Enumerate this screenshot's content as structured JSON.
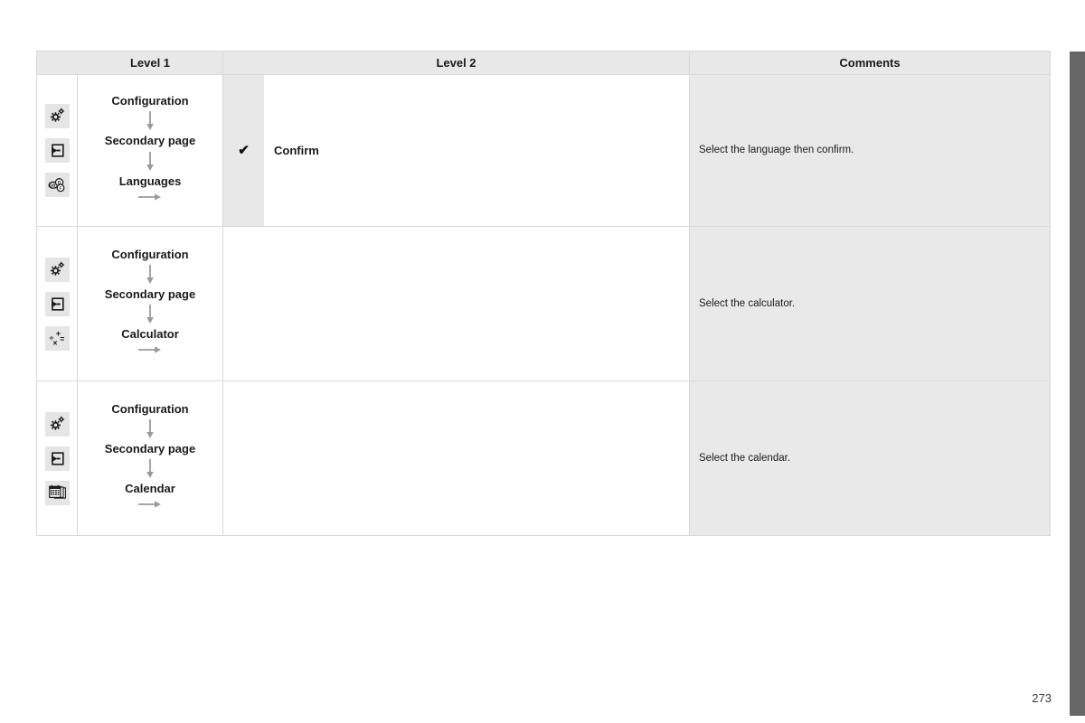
{
  "document": {
    "page_number": "273"
  },
  "table": {
    "headers": {
      "icons": "",
      "level1": "Level 1",
      "level2": "Level 2",
      "comments": "Comments"
    },
    "rows": [
      {
        "icons": [
          "gear-settings-icon",
          "enter-secondary-page-icon",
          "languages-discs-icon"
        ],
        "flow": [
          "Configuration",
          "Secondary page",
          "Languages"
        ],
        "check_mark": "✔",
        "level2_label": "Confirm",
        "comment": "Select the language then confirm."
      },
      {
        "icons": [
          "gear-settings-icon",
          "enter-secondary-page-icon",
          "calculator-icon"
        ],
        "flow": [
          "Configuration",
          "Secondary page",
          "Calculator"
        ],
        "check_mark": "",
        "level2_label": "",
        "comment": "Select the calculator."
      },
      {
        "icons": [
          "gear-settings-icon",
          "enter-secondary-page-icon",
          "calendar-icon"
        ],
        "flow": [
          "Configuration",
          "Secondary page",
          "Calendar"
        ],
        "check_mark": "",
        "level2_label": "",
        "comment": "Select the calendar."
      }
    ]
  },
  "colors": {
    "header_bg": "#e8e8e8",
    "comments_bg": "#e9e9e9",
    "check_bg": "#e8e8e8",
    "border": "#d9d9d9",
    "edge_tab": "#666666",
    "arrow": "#9a9a9a"
  }
}
